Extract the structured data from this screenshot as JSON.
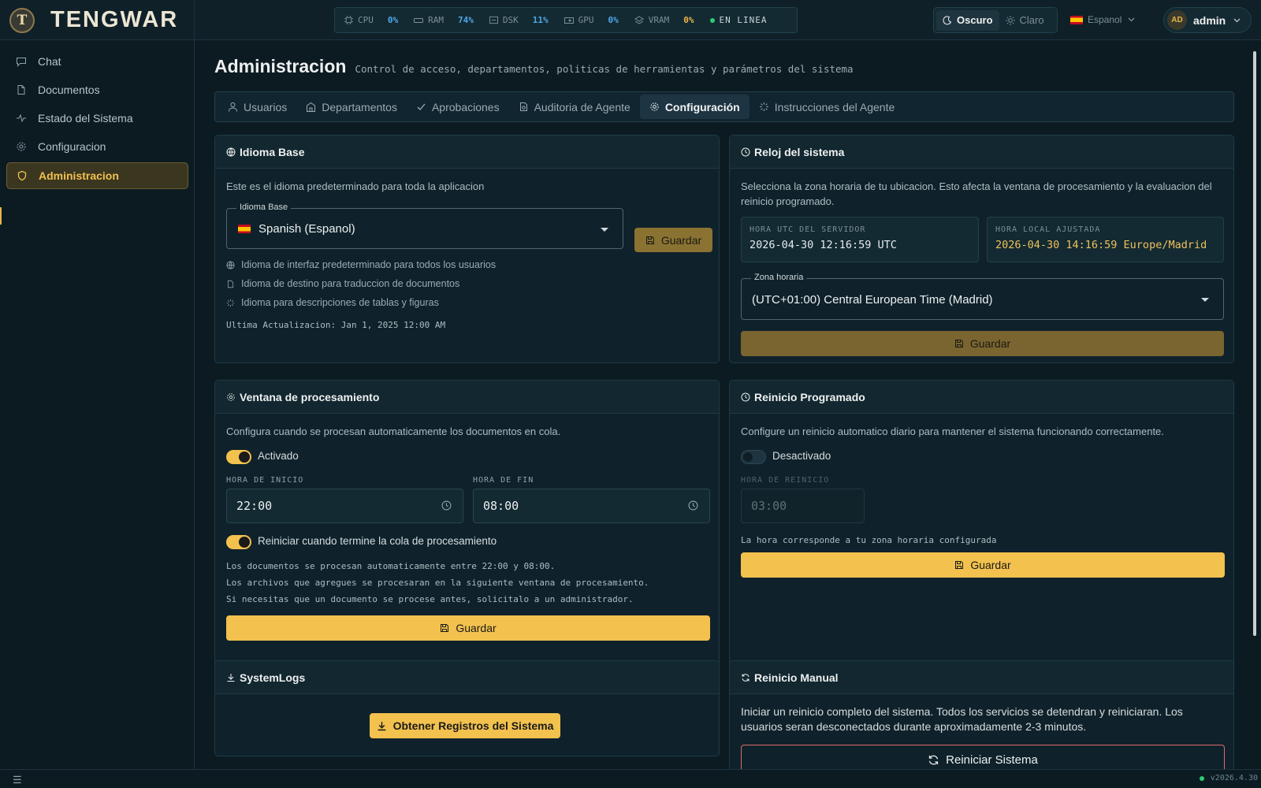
{
  "app": {
    "brand": "TENGWAR",
    "logo_letter": "T",
    "version": "v2026.4.30"
  },
  "metrics": [
    {
      "label": "CPU",
      "value": "0%",
      "color": "#4fa8e6",
      "icon": "cpu-icon"
    },
    {
      "label": "RAM",
      "value": "74%",
      "color": "#4fa8e6",
      "icon": "ram-icon"
    },
    {
      "label": "DSK",
      "value": "11%",
      "color": "#4fa8e6",
      "icon": "disk-icon"
    },
    {
      "label": "GPU",
      "value": "0%",
      "color": "#4fa8e6",
      "icon": "gpu-icon"
    },
    {
      "label": "VRAM",
      "value": "0%",
      "color": "#e8b54a",
      "icon": "layers-icon"
    }
  ],
  "status": {
    "label": "EN LINEA",
    "color": "#2ecc71"
  },
  "theme": {
    "dark": "Oscuro",
    "light": "Claro",
    "selected": "Oscuro"
  },
  "language": {
    "label": "Espanol"
  },
  "user": {
    "initials": "AD",
    "name": "admin"
  },
  "sidebar": {
    "items": [
      {
        "label": "Chat",
        "icon": "chat-icon"
      },
      {
        "label": "Documentos",
        "icon": "document-icon"
      },
      {
        "label": "Estado del Sistema",
        "icon": "activity-icon"
      },
      {
        "label": "Configuracion",
        "icon": "gear-icon"
      },
      {
        "label": "Administracion",
        "icon": "shield-icon",
        "active": true
      }
    ]
  },
  "page": {
    "title": "Administracion",
    "subtitle": "Control de acceso, departamentos, politicas de herramientas y parámetros del sistema"
  },
  "tabs": [
    {
      "label": "Usuarios",
      "icon": "user-icon"
    },
    {
      "label": "Departamentos",
      "icon": "building-icon"
    },
    {
      "label": "Aprobaciones",
      "icon": "check-icon"
    },
    {
      "label": "Auditoria de Agente",
      "icon": "audit-icon"
    },
    {
      "label": "Configuración",
      "icon": "gear-icon",
      "active": true
    },
    {
      "label": "Instrucciones del Agente",
      "icon": "spinner-icon"
    }
  ],
  "idioma": {
    "title": "Idioma Base",
    "description": "Este es el idioma predeterminado para toda la aplicacion",
    "field_label": "Idioma Base",
    "selected": "Spanish (Espanol)",
    "save": "Guardar",
    "hints": [
      "Idioma de interfaz predeterminado para todos los usuarios",
      "Idioma de destino para traduccion de documentos",
      "Idioma para descripciones de tablas y figuras"
    ],
    "last_update": "Ultima Actualizacion: Jan 1, 2025 12:00 AM"
  },
  "reloj": {
    "title": "Reloj del sistema",
    "description": "Selecciona la zona horaria de tu ubicacion. Esto afecta la ventana de procesamiento y la evaluacion del reinicio programado.",
    "utc_label": "HORA UTC DEL SERVIDOR",
    "utc_value": "2026-04-30 12:16:59 UTC",
    "local_label": "HORA LOCAL AJUSTADA",
    "local_value": "2026-04-30 14:16:59 Europe/Madrid",
    "tz_label": "Zona horaria",
    "tz_value": "(UTC+01:00) Central European Time (Madrid)",
    "save": "Guardar"
  },
  "ventana": {
    "title": "Ventana de procesamiento",
    "description": "Configura cuando se procesan automaticamente los documentos en cola.",
    "enabled_label": "Activado",
    "enabled": true,
    "start_label": "HORA DE INICIO",
    "start_value": "22:00",
    "end_label": "HORA DE FIN",
    "end_value": "08:00",
    "restart_label": "Reiniciar cuando termine la cola de procesamiento",
    "restart_enabled": true,
    "notes": [
      "Los documentos se procesan automaticamente entre 22:00 y 08:00.",
      "Los archivos que agregues se procesaran en la siguiente ventana de procesamiento.",
      "Si necesitas que un documento se procese antes, solicitalo a un administrador."
    ],
    "save": "Guardar"
  },
  "reinicio": {
    "title": "Reinicio Programado",
    "description": "Configure un reinicio automatico diario para mantener el sistema funcionando correctamente.",
    "enabled_label": "Desactivado",
    "enabled": false,
    "time_label": "HORA DE REINICIO",
    "time_value": "03:00",
    "note": "La hora corresponde a tu zona horaria configurada",
    "save": "Guardar"
  },
  "logs": {
    "title": "SystemLogs",
    "button": "Obtener Registros del Sistema"
  },
  "manual": {
    "title": "Reinicio Manual",
    "description": "Iniciar un reinicio completo del sistema. Todos los servicios se detendran y reiniciaran. Los usuarios seran desconectados durante aproximadamente 2-3 minutos.",
    "button": "Reiniciar Sistema"
  }
}
